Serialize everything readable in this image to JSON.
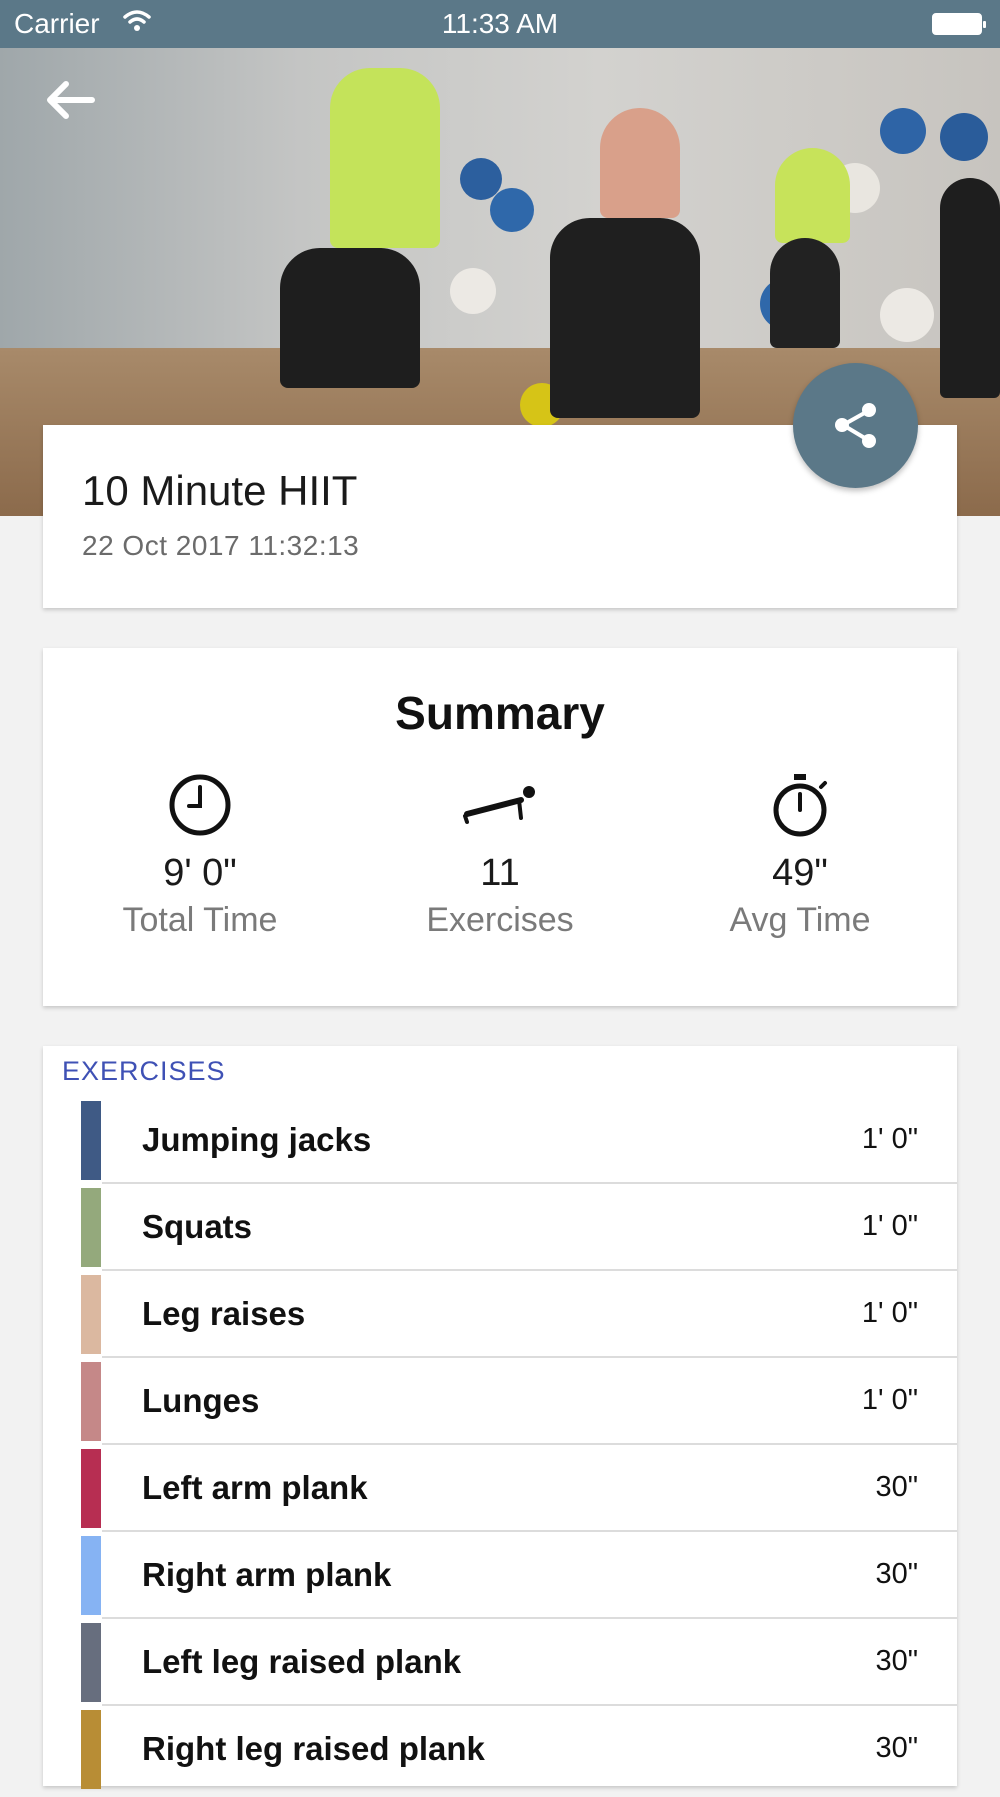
{
  "status_bar": {
    "carrier": "Carrier",
    "time": "11:33 AM"
  },
  "workout": {
    "title": "10 Minute HIIT",
    "date": "22 Oct 2017 11:32:13"
  },
  "summary": {
    "heading": "Summary",
    "stats": [
      {
        "icon": "clock-icon",
        "value": "9' 0\"",
        "label": "Total Time"
      },
      {
        "icon": "pushup-icon",
        "value": "11",
        "label": "Exercises"
      },
      {
        "icon": "stopwatch-icon",
        "value": "49\"",
        "label": "Avg Time"
      }
    ]
  },
  "exercises": {
    "section_label": "EXERCISES",
    "items": [
      {
        "name": "Jumping jacks",
        "duration": "1' 0\"",
        "color": "#3f5a85"
      },
      {
        "name": "Squats",
        "duration": "1' 0\"",
        "color": "#94a97c"
      },
      {
        "name": "Leg raises",
        "duration": "1' 0\"",
        "color": "#dbb8a0"
      },
      {
        "name": "Lunges",
        "duration": "1' 0\"",
        "color": "#c58888"
      },
      {
        "name": "Left arm plank",
        "duration": "30\"",
        "color": "#b72e52"
      },
      {
        "name": "Right arm plank",
        "duration": "30\"",
        "color": "#86b3f3"
      },
      {
        "name": "Left leg raised plank",
        "duration": "30\"",
        "color": "#676e7e"
      },
      {
        "name": "Right leg raised plank",
        "duration": "30\"",
        "color": "#b88d35"
      }
    ]
  },
  "colors": {
    "status_bar": "#5b7888",
    "share_button": "#5b7888",
    "section_label": "#3f51b5"
  }
}
